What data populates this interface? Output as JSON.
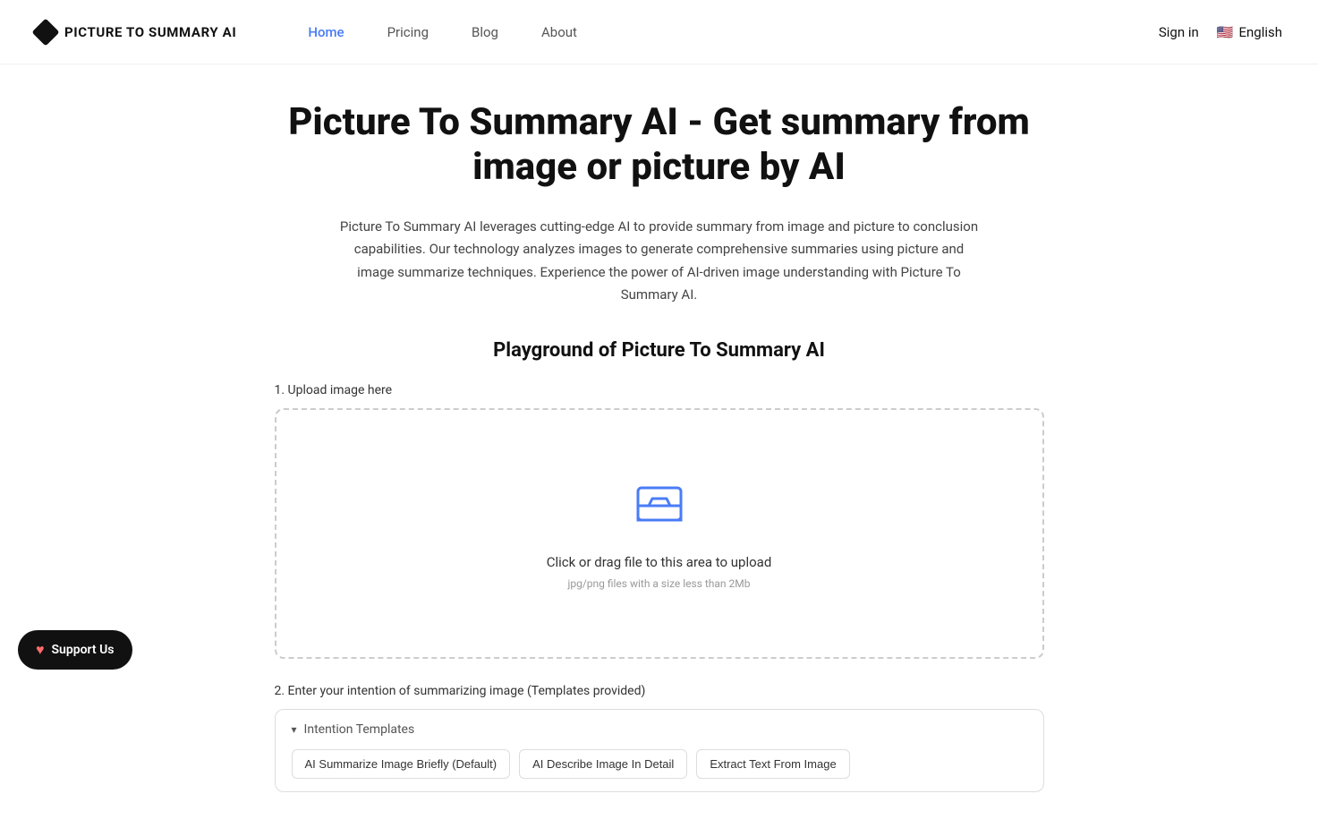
{
  "nav": {
    "logo_text": "PICTURE TO SUMMARY AI",
    "links": [
      {
        "label": "Home",
        "active": true
      },
      {
        "label": "Pricing",
        "active": false
      },
      {
        "label": "Blog",
        "active": false
      },
      {
        "label": "About",
        "active": false
      }
    ],
    "sign_in": "Sign in",
    "language": "English"
  },
  "hero": {
    "title": "Picture To Summary AI - Get summary from image or picture by AI",
    "description": "Picture To Summary AI leverages cutting-edge AI to provide summary from image and picture to conclusion capabilities. Our technology analyzes images to generate comprehensive summaries using picture and image summarize techniques. Experience the power of AI-driven image understanding with Picture To Summary AI.",
    "playground_title": "Playground of Picture To Summary AI"
  },
  "upload": {
    "section_label": "1. Upload image here",
    "main_text": "Click or drag file to this area to upload",
    "sub_text": "jpg/png files with a size less than 2Mb"
  },
  "intention": {
    "section_label": "2. Enter your intention of summarizing image (Templates provided)",
    "header_label": "Intention Templates",
    "templates": [
      {
        "label": "AI Summarize Image Briefly (Default)"
      },
      {
        "label": "AI Describe Image In Detail"
      },
      {
        "label": "Extract Text From Image"
      }
    ]
  },
  "support": {
    "label": "Support Us"
  }
}
